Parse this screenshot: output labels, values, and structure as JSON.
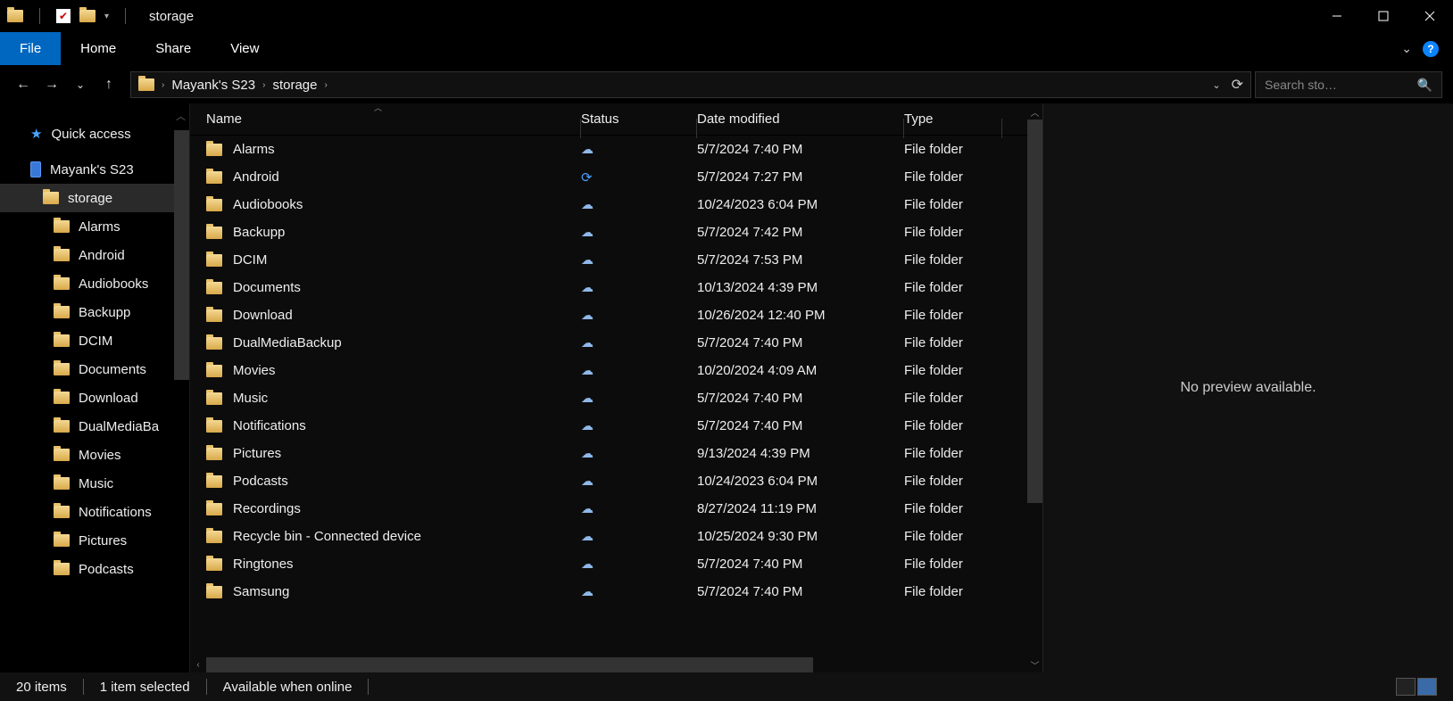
{
  "title": "storage",
  "ribbon": {
    "file": "File",
    "home": "Home",
    "share": "Share",
    "view": "View"
  },
  "breadcrumb": [
    "Mayank's S23",
    "storage"
  ],
  "search_placeholder": "Search sto…",
  "tree": {
    "quick_access": "Quick access",
    "device": "Mayank's S23",
    "storage": "storage",
    "items": [
      "Alarms",
      "Android",
      "Audiobooks",
      "Backupp",
      "DCIM",
      "Documents",
      "Download",
      "DualMediaBa",
      "Movies",
      "Music",
      "Notifications",
      "Pictures",
      "Podcasts"
    ]
  },
  "columns": {
    "name": "Name",
    "status": "Status",
    "date": "Date modified",
    "type": "Type"
  },
  "rows": [
    {
      "name": "Alarms",
      "status": "cloud",
      "date": "5/7/2024 7:40 PM",
      "type": "File folder"
    },
    {
      "name": "Android",
      "status": "sync",
      "date": "5/7/2024 7:27 PM",
      "type": "File folder"
    },
    {
      "name": "Audiobooks",
      "status": "cloud",
      "date": "10/24/2023 6:04 PM",
      "type": "File folder"
    },
    {
      "name": "Backupp",
      "status": "cloud",
      "date": "5/7/2024 7:42 PM",
      "type": "File folder"
    },
    {
      "name": "DCIM",
      "status": "cloud",
      "date": "5/7/2024 7:53 PM",
      "type": "File folder"
    },
    {
      "name": "Documents",
      "status": "cloud",
      "date": "10/13/2024 4:39 PM",
      "type": "File folder"
    },
    {
      "name": "Download",
      "status": "cloud",
      "date": "10/26/2024 12:40 PM",
      "type": "File folder"
    },
    {
      "name": "DualMediaBackup",
      "status": "cloud",
      "date": "5/7/2024 7:40 PM",
      "type": "File folder"
    },
    {
      "name": "Movies",
      "status": "cloud",
      "date": "10/20/2024 4:09 AM",
      "type": "File folder"
    },
    {
      "name": "Music",
      "status": "cloud",
      "date": "5/7/2024 7:40 PM",
      "type": "File folder"
    },
    {
      "name": "Notifications",
      "status": "cloud",
      "date": "5/7/2024 7:40 PM",
      "type": "File folder"
    },
    {
      "name": "Pictures",
      "status": "cloud",
      "date": "9/13/2024 4:39 PM",
      "type": "File folder"
    },
    {
      "name": "Podcasts",
      "status": "cloud",
      "date": "10/24/2023 6:04 PM",
      "type": "File folder"
    },
    {
      "name": "Recordings",
      "status": "cloud",
      "date": "8/27/2024 11:19 PM",
      "type": "File folder"
    },
    {
      "name": "Recycle bin - Connected device",
      "status": "cloud",
      "date": "10/25/2024 9:30 PM",
      "type": "File folder"
    },
    {
      "name": "Ringtones",
      "status": "cloud",
      "date": "5/7/2024 7:40 PM",
      "type": "File folder"
    },
    {
      "name": "Samsung",
      "status": "cloud",
      "date": "5/7/2024 7:40 PM",
      "type": "File folder"
    }
  ],
  "preview": "No preview available.",
  "status": {
    "count": "20 items",
    "selected": "1 item selected",
    "avail": "Available when online"
  }
}
